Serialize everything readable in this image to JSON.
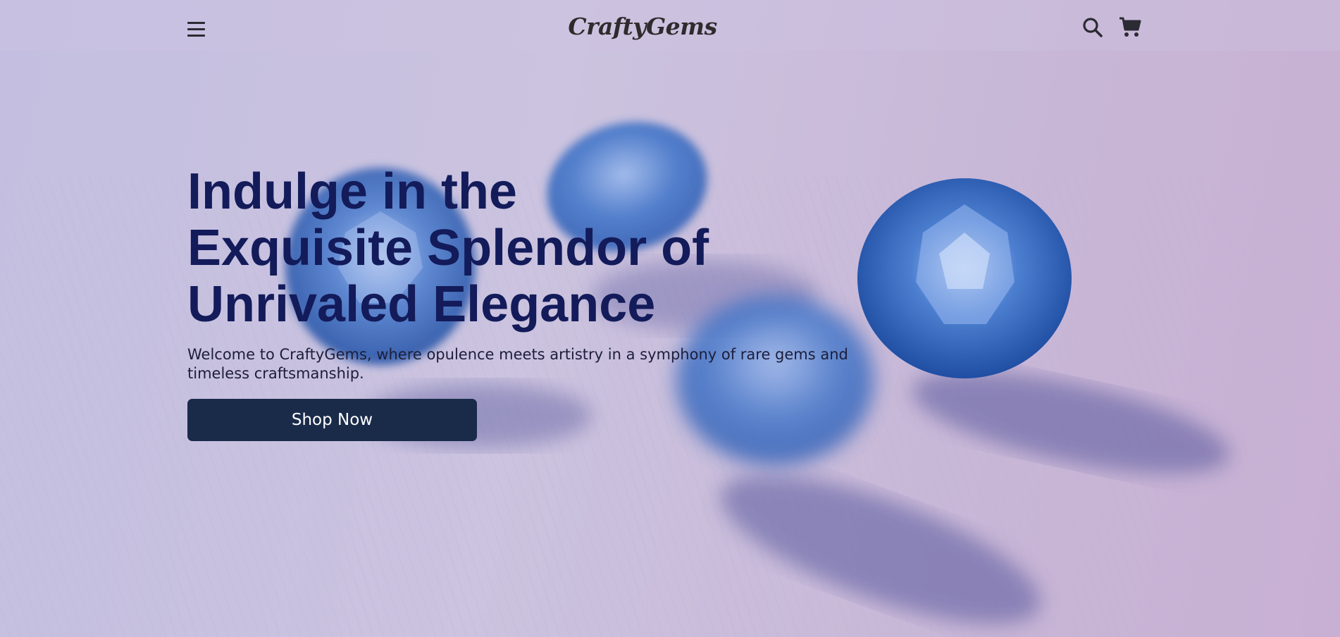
{
  "header": {
    "logo": "CraftyGems",
    "menu_icon": "hamburger-menu-icon",
    "search_icon": "search-icon",
    "cart_icon": "shopping-cart-icon"
  },
  "hero": {
    "headline": "Indulge in the Exquisite Splendor of Unrivaled Elegance",
    "subtitle": "Welcome to CraftyGems, where opulence meets artistry in a symphony of rare gems and timeless craftsmanship.",
    "cta_label": "Shop Now",
    "background_image": "blue-gemstones-photo"
  },
  "colors": {
    "headline": "#131b5a",
    "button_bg": "#1a2b4a",
    "button_text": "#ffffff",
    "background_tint": "#c9c0dc"
  }
}
